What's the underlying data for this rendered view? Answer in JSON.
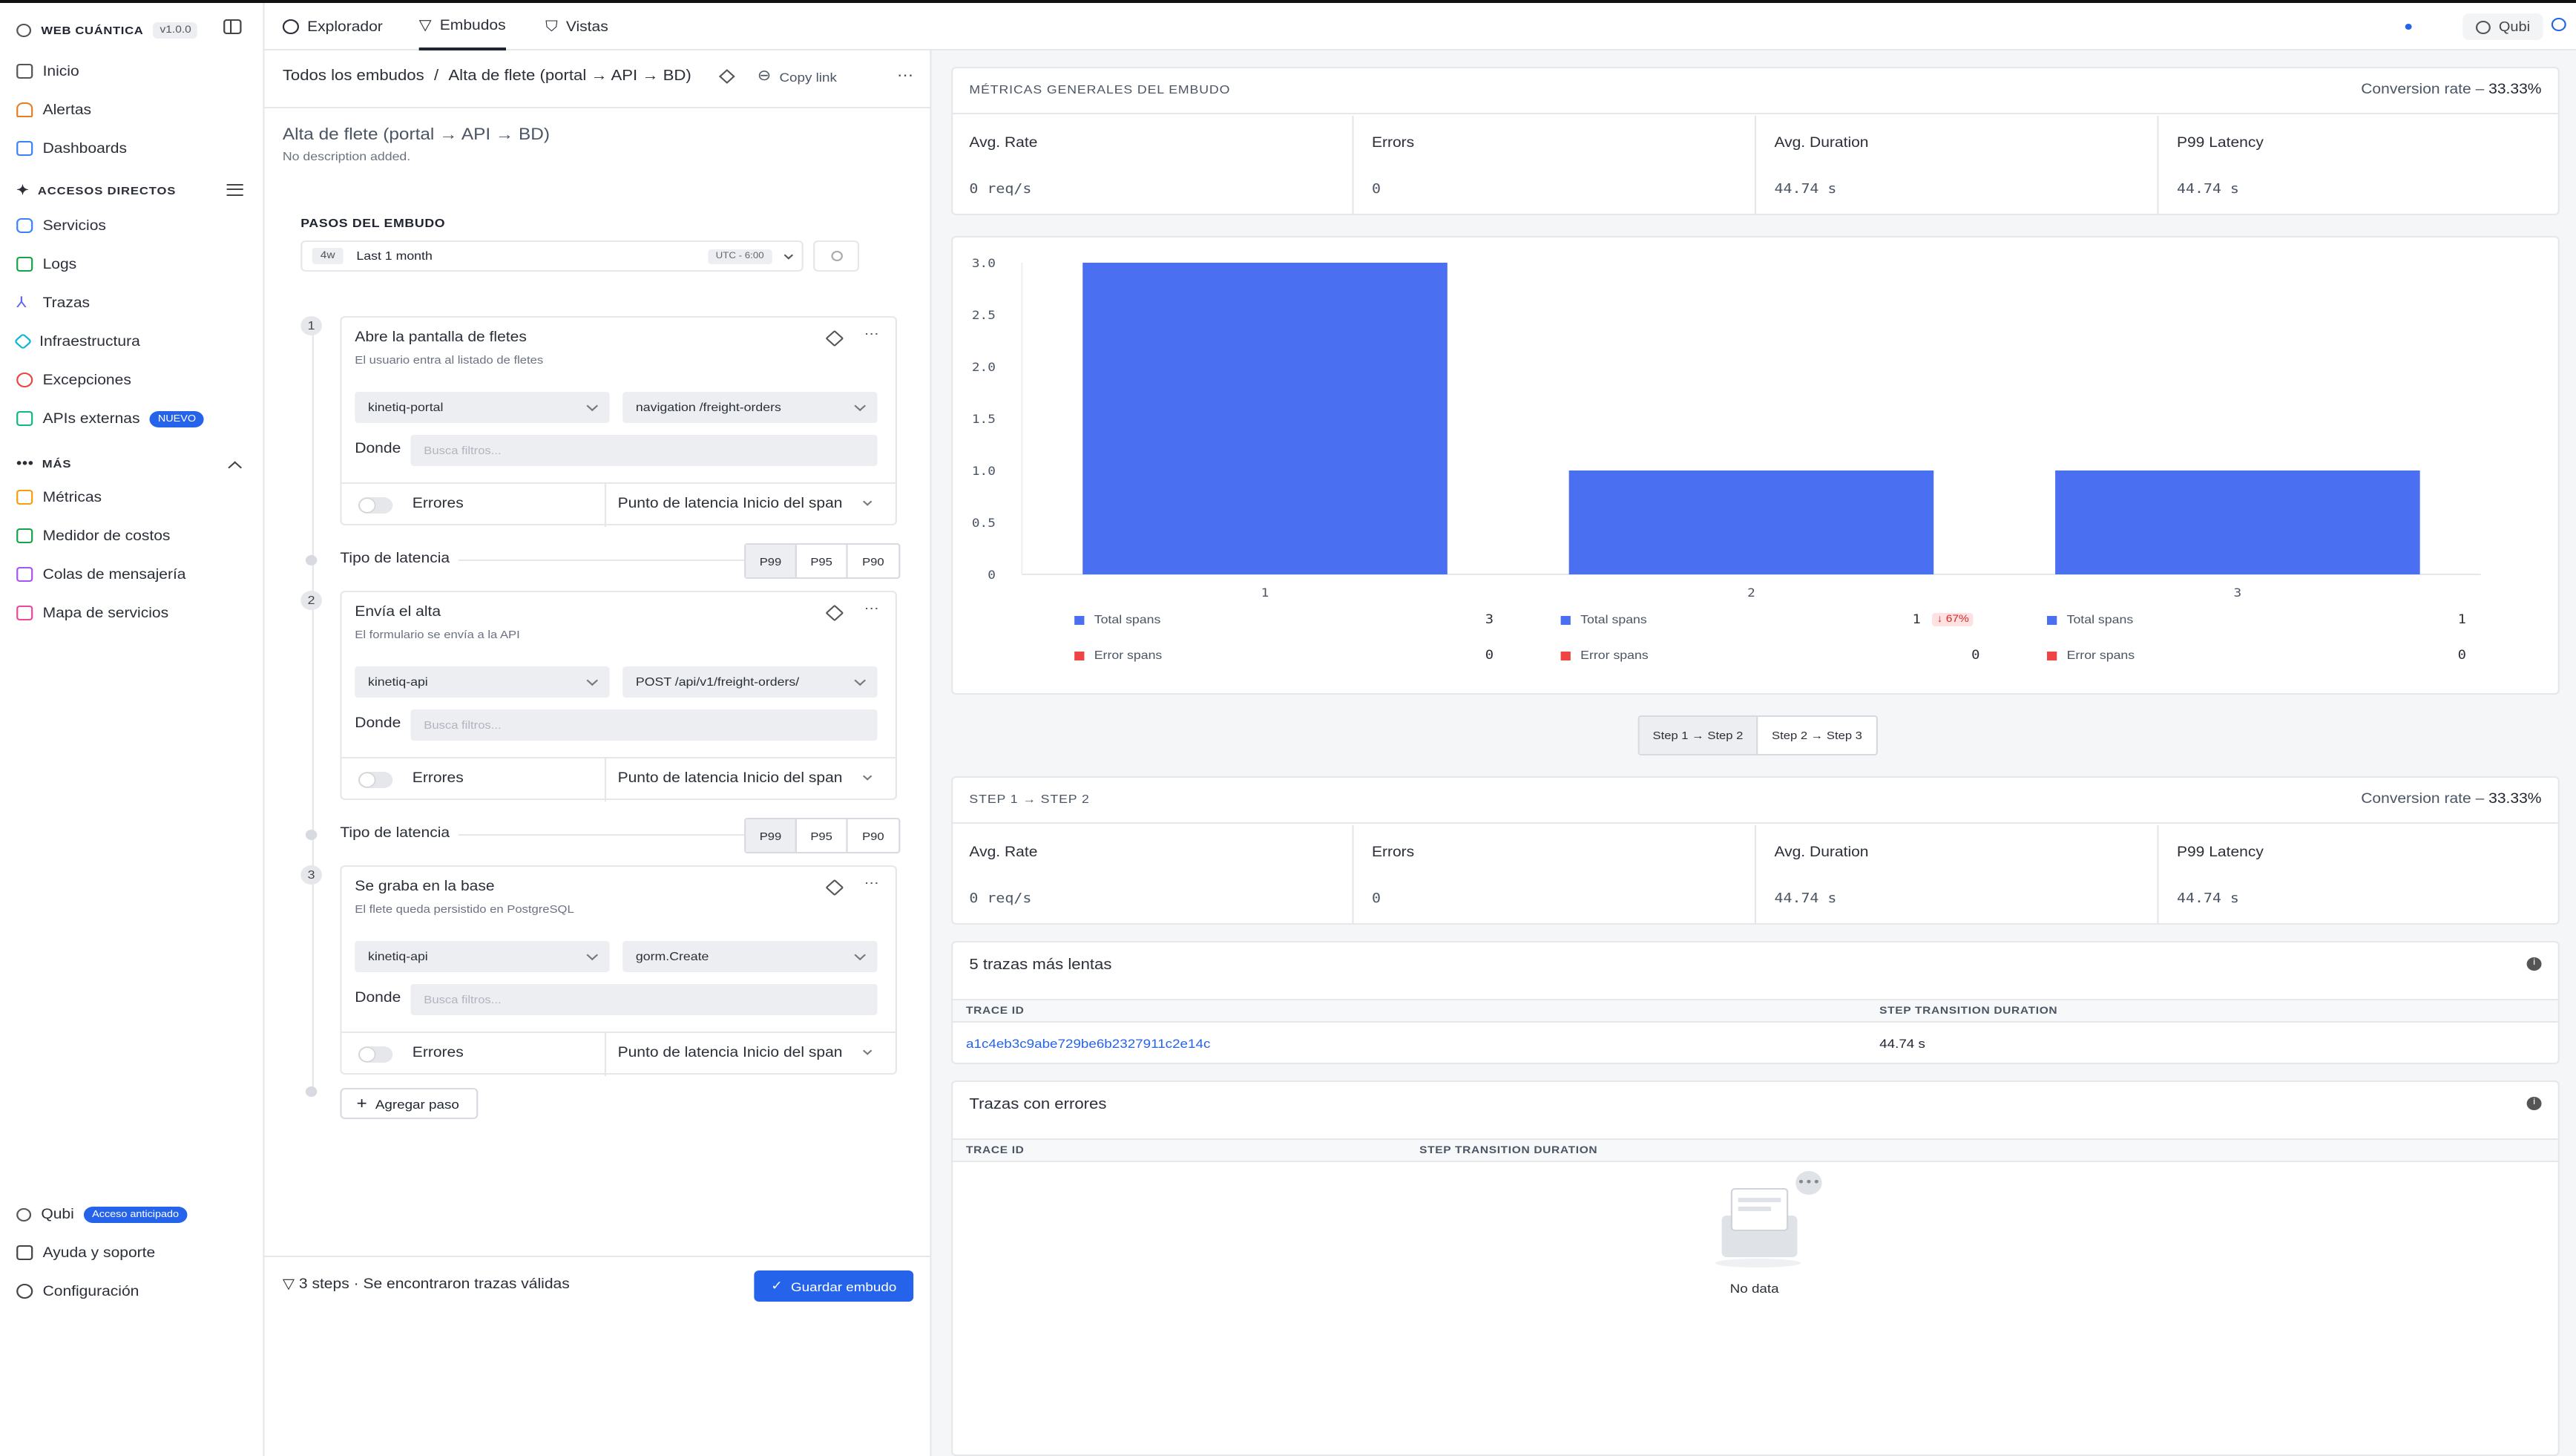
{
  "sidebar": {
    "brand": "WEB CUÁNTICA",
    "version": "v1.0.0",
    "items": [
      {
        "label": "Inicio",
        "color": "#555"
      },
      {
        "label": "Alertas",
        "color": "#e67e22"
      },
      {
        "label": "Dashboards",
        "color": "#3b82f6"
      }
    ],
    "shortcuts_title": "ACCESOS DIRECTOS",
    "shortcuts": [
      {
        "label": "Servicios",
        "color": "#3b82f6"
      },
      {
        "label": "Logs",
        "color": "#16a34a"
      },
      {
        "label": "Trazas",
        "color": "#6366f1"
      },
      {
        "label": "Infraestructura",
        "color": "#06b6d4"
      },
      {
        "label": "Excepciones",
        "color": "#ef4444"
      },
      {
        "label": "APIs externas",
        "color": "#10b981",
        "badge": "NUEVO"
      }
    ],
    "more_title": "MÁS",
    "more": [
      {
        "label": "Métricas",
        "color": "#f59e0b"
      },
      {
        "label": "Medidor de costos",
        "color": "#16a34a"
      },
      {
        "label": "Colas de mensajería",
        "color": "#a855f7"
      },
      {
        "label": "Mapa de servicios",
        "color": "#ec4899"
      }
    ],
    "bottom": {
      "qubi": "Qubi",
      "qubi_badge": "Acceso anticipado",
      "help": "Ayuda y soporte",
      "settings": "Configuración"
    }
  },
  "topnav": {
    "tabs": [
      "Explorador",
      "Embudos",
      "Vistas"
    ],
    "active_tab": "Embudos",
    "qubi": "Qubi"
  },
  "funnel": {
    "breadcrumb_root": "Todos los embudos",
    "breadcrumb_sep": "/",
    "breadcrumb_current": "Alta de flete (portal → API → BD)",
    "copy_link": "Copy link",
    "title": "Alta de flete (portal → API → BD)",
    "description": "No description added.",
    "steps_title": "PASOS DEL EMBUDO",
    "time_tag": "4w",
    "time_label": "Last 1 month",
    "timezone": "UTC - 6:00",
    "steps": [
      {
        "num": "1",
        "title": "Abre la pantalla de fletes",
        "subtitle": "El usuario entra al listado de fletes",
        "service": "kinetiq-portal",
        "span": "navigation /freight-orders"
      },
      {
        "num": "2",
        "title": "Envía el alta",
        "subtitle": "El formulario se envía a la API",
        "service": "kinetiq-api",
        "span": "POST /api/v1/freight-orders/"
      },
      {
        "num": "3",
        "title": "Se graba en la base",
        "subtitle": "El flete queda persistido en PostgreSQL",
        "service": "kinetiq-api",
        "span": "gorm.Create"
      }
    ],
    "where_label": "Donde",
    "filter_placeholder": "Busca filtros...",
    "errors_label": "Errores",
    "latency_point": "Punto de latencia Inicio del span",
    "latency_type_label": "Tipo de latencia",
    "percentiles": [
      "P99",
      "P95",
      "P90"
    ],
    "selected_percentile": "P99",
    "add_step": "Agregar paso",
    "footer_steps": "3 steps",
    "footer_sep": "·",
    "footer_status": "Se encontraron trazas válidas",
    "save": "Guardar embudo"
  },
  "overall": {
    "title": "MÉTRICAS GENERALES DEL EMBUDO",
    "conversion_label": "Conversion rate",
    "conversion_sep": "–",
    "conversion_value": "33.33%",
    "metrics": [
      {
        "label": "Avg. Rate",
        "value": "0 req/s"
      },
      {
        "label": "Errors",
        "value": "0"
      },
      {
        "label": "Avg. Duration",
        "value": "44.74 s"
      },
      {
        "label": "P99 Latency",
        "value": "44.74 s"
      }
    ]
  },
  "chart_data": {
    "type": "bar",
    "categories": [
      "1",
      "2",
      "3"
    ],
    "series": [
      {
        "name": "Total spans",
        "values": [
          3,
          1,
          1
        ],
        "color": "#4a6ff0"
      },
      {
        "name": "Error spans",
        "values": [
          0,
          0,
          0
        ],
        "color": "#ef4444"
      }
    ],
    "ylim": [
      0,
      3.0
    ],
    "yticks": [
      "0",
      "0.5",
      "1.0",
      "1.5",
      "2.0",
      "2.5",
      "3.0"
    ],
    "change_badges": [
      "",
      "↓ 67%",
      ""
    ],
    "xlabel": "",
    "ylabel": ""
  },
  "step_switch": [
    "Step 1 → Step 2",
    "Step 2 → Step 3"
  ],
  "step_metrics": {
    "title": "STEP 1 → STEP 2",
    "conversion_label": "Conversion rate",
    "conversion_sep": "–",
    "conversion_value": "33.33%",
    "metrics": [
      {
        "label": "Avg. Rate",
        "value": "0 req/s"
      },
      {
        "label": "Errors",
        "value": "0"
      },
      {
        "label": "Avg. Duration",
        "value": "44.74 s"
      },
      {
        "label": "P99 Latency",
        "value": "44.74 s"
      }
    ]
  },
  "slow_traces": {
    "title": "5 trazas más lentas",
    "col_trace": "TRACE ID",
    "col_duration": "STEP TRANSITION DURATION",
    "rows": [
      {
        "trace_id": "a1c4eb3c9abe729be6b2327911c2e14c",
        "duration": "44.74 s"
      }
    ]
  },
  "error_traces": {
    "title": "Trazas con errores",
    "col_trace": "TRACE ID",
    "col_duration": "STEP TRANSITION DURATION",
    "empty": "No data"
  }
}
